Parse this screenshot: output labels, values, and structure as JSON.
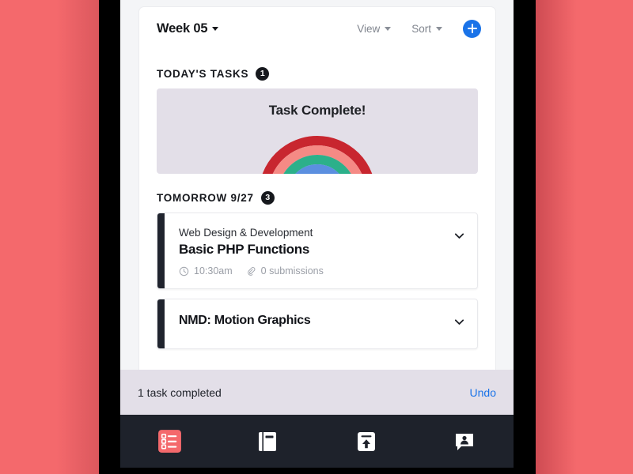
{
  "theme": {
    "backdrop_color": "#F4696C",
    "bezel_color": "#000000",
    "screen_bg": "#F4F5F7",
    "accent_blue": "#1A73E8",
    "nav_bg": "#1E222B",
    "nav_active_color": "#F4696C",
    "snackbar_bg": "#E3DFE8",
    "panel_bg": "#E3DFE8",
    "card_accent": "#20242E"
  },
  "header": {
    "title": "Week 05",
    "title_caret": "chevron-down-icon",
    "view_label": "View",
    "sort_label": "Sort",
    "add_label": "+"
  },
  "sections": [
    {
      "title": "TODAY'S TASKS",
      "count": "1"
    },
    {
      "title": "TOMORROW 9/27",
      "count": "3"
    }
  ],
  "complete_panel": {
    "message": "Task Complete!",
    "illustration": "rainbow-illustration",
    "arc_colors": [
      "#C8262F",
      "#F58A85",
      "#2CB08A",
      "#5B8FE0",
      "#6B7BA8"
    ]
  },
  "tasks": [
    {
      "course": "Web Design & Development",
      "title": "Basic PHP Functions",
      "time": "10:30am",
      "time_icon": "clock-icon",
      "submissions": "0 submissions",
      "submissions_icon": "paperclip-icon",
      "expand_icon": "chevron-down-icon"
    },
    {
      "course": "NMD: Motion Graphics",
      "title": "",
      "time": "",
      "submissions": "",
      "expand_icon": "chevron-down-icon"
    }
  ],
  "snackbar": {
    "message": "1 task completed",
    "action_label": "Undo"
  },
  "bottom_nav": [
    {
      "icon": "task-list-icon",
      "active": true
    },
    {
      "icon": "book-icon",
      "active": false
    },
    {
      "icon": "inbox-upload-icon",
      "active": false
    },
    {
      "icon": "chat-person-icon",
      "active": false
    }
  ]
}
